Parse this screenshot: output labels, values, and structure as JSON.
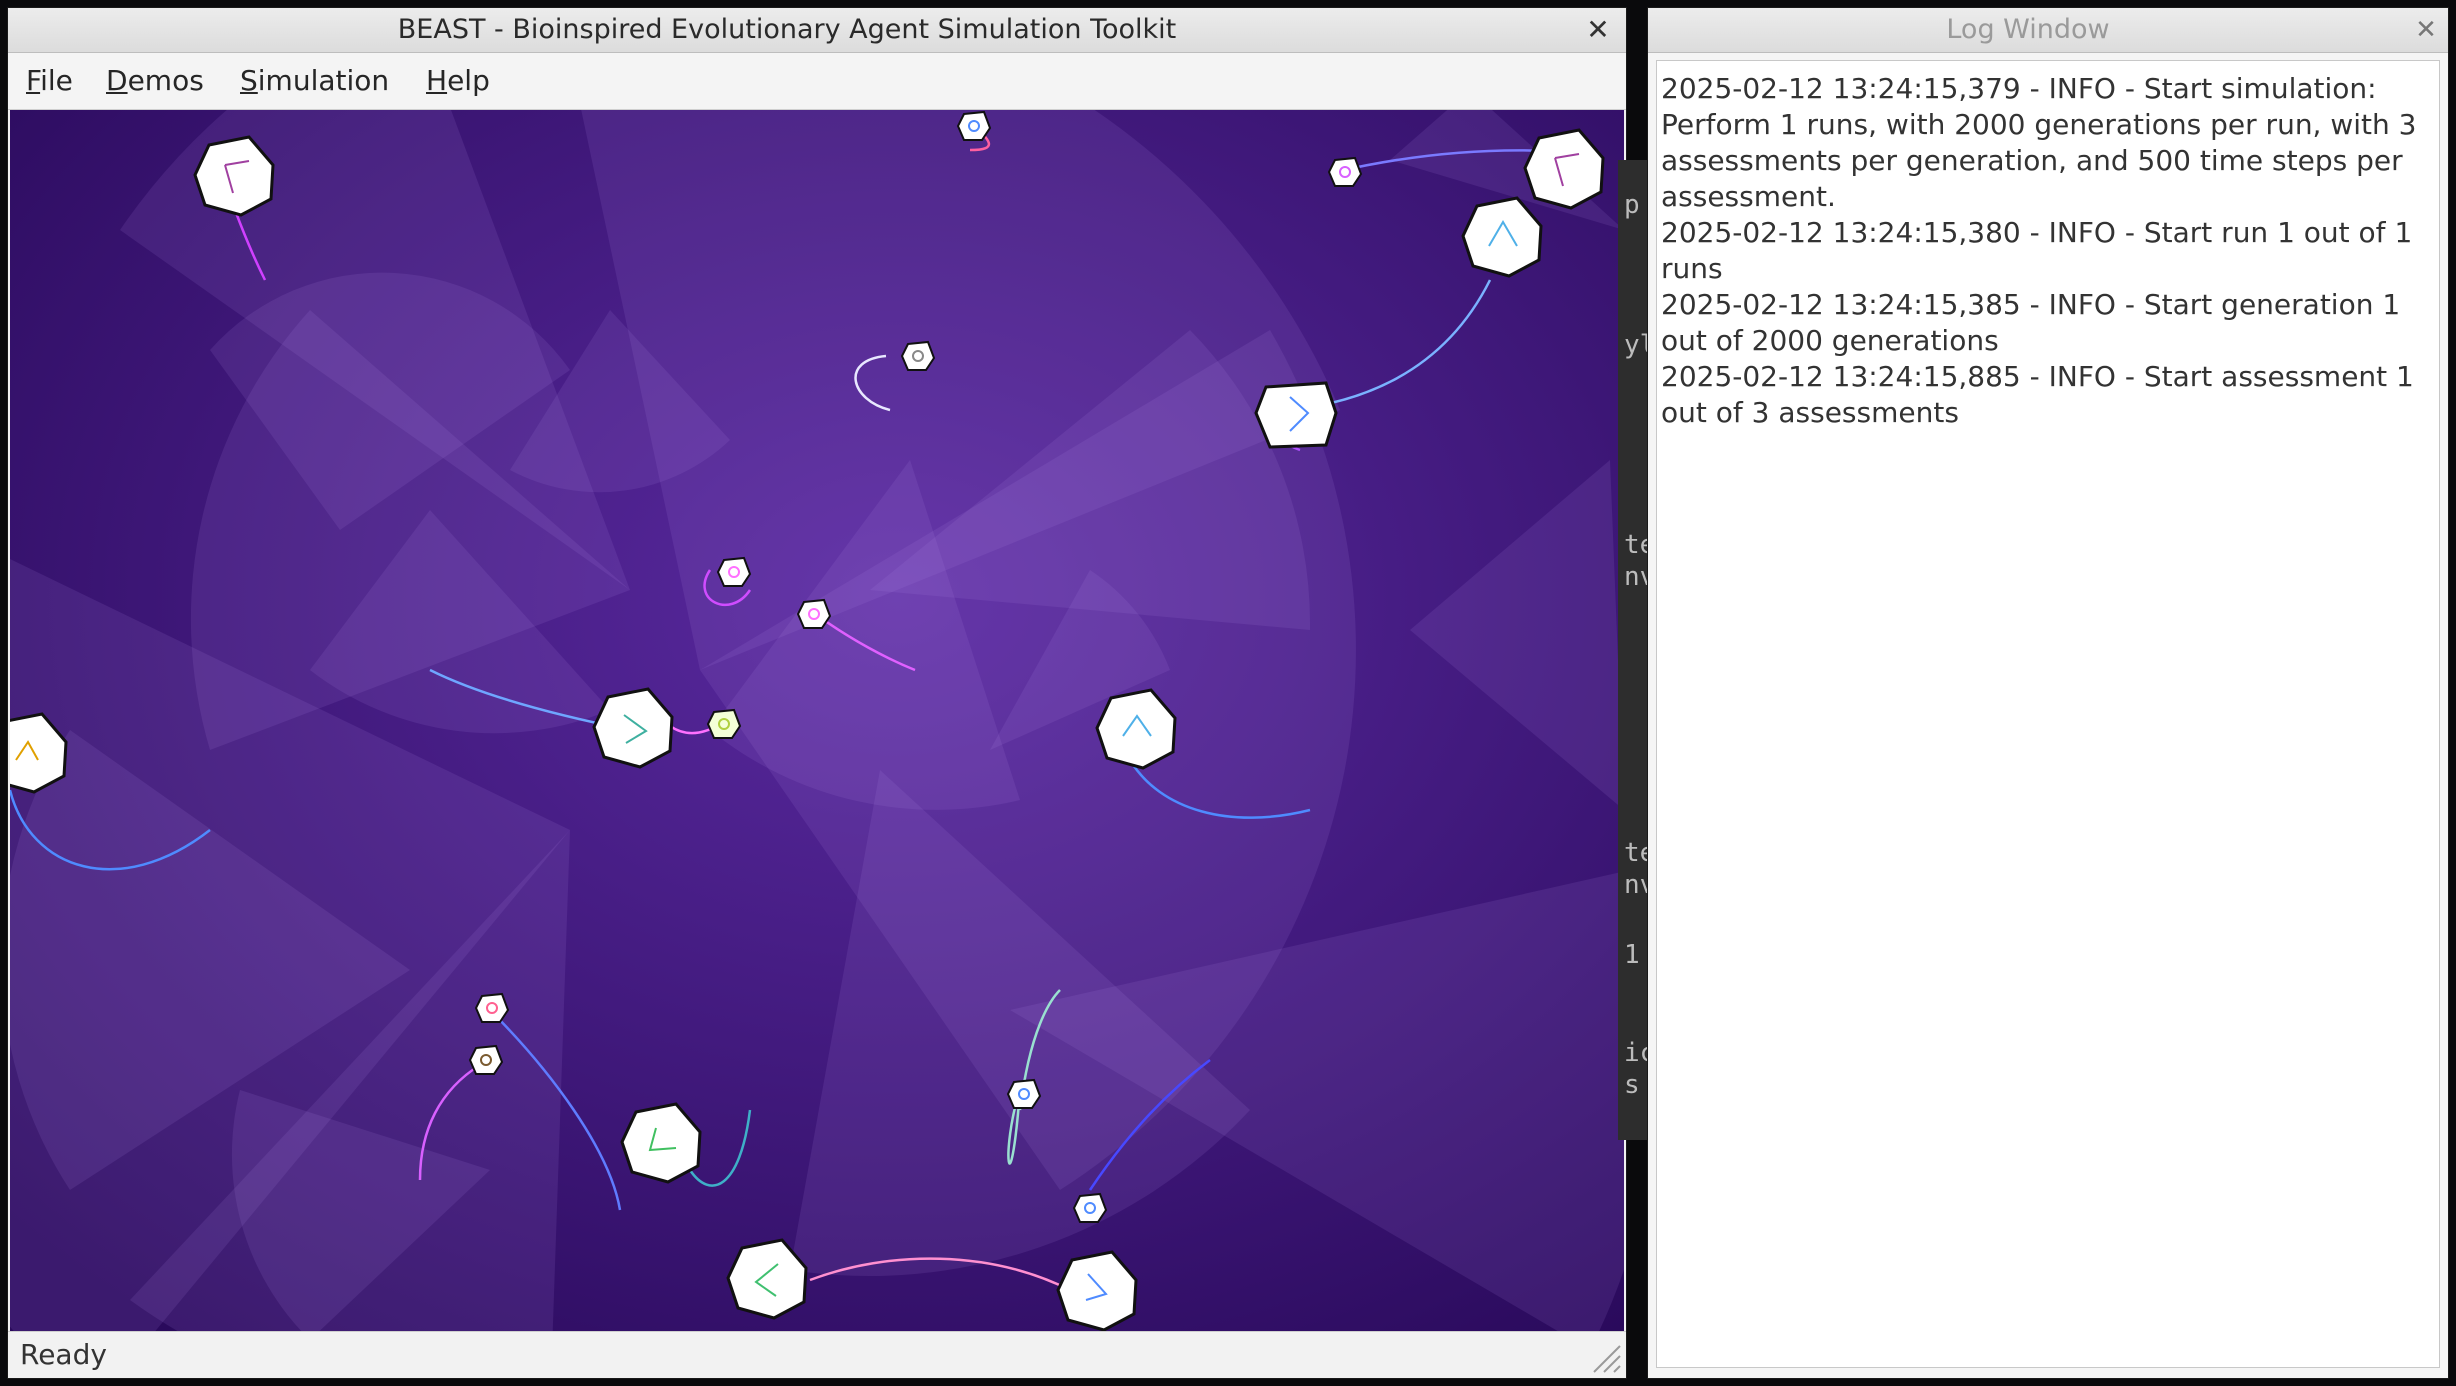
{
  "main_window": {
    "title": "BEAST - Bioinspired Evolutionary Agent Simulation Toolkit",
    "menu": [
      {
        "label": "File",
        "mnemonic": "F",
        "rest": "ile"
      },
      {
        "label": "Demos",
        "mnemonic": "D",
        "rest": "emos"
      },
      {
        "label": "Simulation",
        "mnemonic": "S",
        "rest": "imulation"
      },
      {
        "label": "Help",
        "mnemonic": "H",
        "rest": "elp"
      }
    ],
    "status": "Ready",
    "close_icon": "close-icon"
  },
  "log_window": {
    "title": "Log Window",
    "entries": [
      "2025-02-12 13:24:15,379 - INFO - Start simulation: Perform 1 runs, with 2000 generations per run, with 3 assessments per generation, and 500 time steps per assessment.",
      "2025-02-12 13:24:15,380 - INFO - Start run 1 out of 1 runs",
      "2025-02-12 13:24:15,385 - INFO - Start generation 1 out of 2000 generations",
      "2025-02-12 13:24:15,885 - INFO - Start assessment 1 out of 3 assessments"
    ]
  },
  "background_window": {
    "snippets": [
      "p",
      "yl",
      "te",
      "nv",
      "te",
      "nv",
      "1",
      "ic",
      "s"
    ]
  },
  "colors": {
    "canvas_background": "#3b1170",
    "sensor_cone": "#b48ee6"
  }
}
